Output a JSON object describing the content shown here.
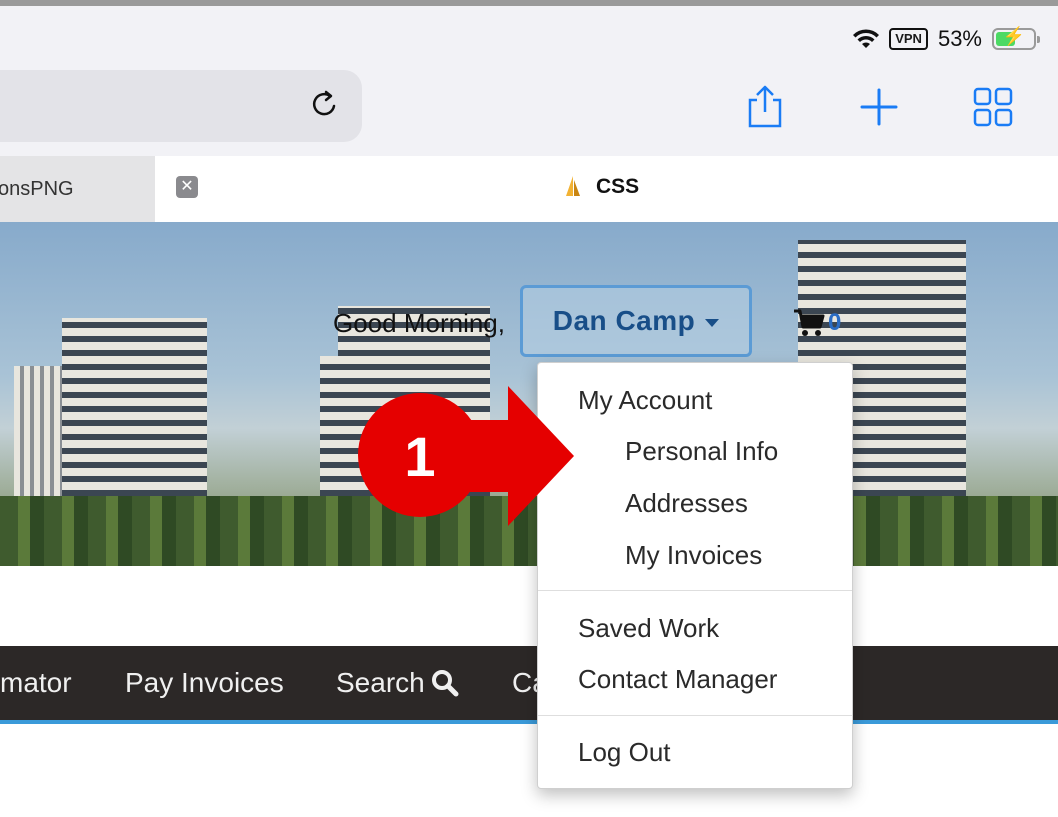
{
  "status_bar": {
    "vpn": "VPN",
    "battery_percent": "53%",
    "battery_level": 0.53
  },
  "tabs": [
    {
      "label": "onsPNG",
      "close": "✕"
    },
    {
      "label": "CSS"
    }
  ],
  "header": {
    "greeting": "Good Morning,",
    "user_name": "Dan Camp",
    "cart_count": "0"
  },
  "nav": [
    "mator",
    "Pay Invoices",
    "Search",
    "Ca"
  ],
  "dropdown": {
    "section1_title": "My Account",
    "section1_items": [
      "Personal Info",
      "Addresses",
      "My Invoices"
    ],
    "section2_items": [
      "Saved Work",
      "Contact Manager"
    ],
    "section3_items": [
      "Log Out"
    ]
  },
  "annotation": {
    "step": "1",
    "color": "#e50000"
  }
}
